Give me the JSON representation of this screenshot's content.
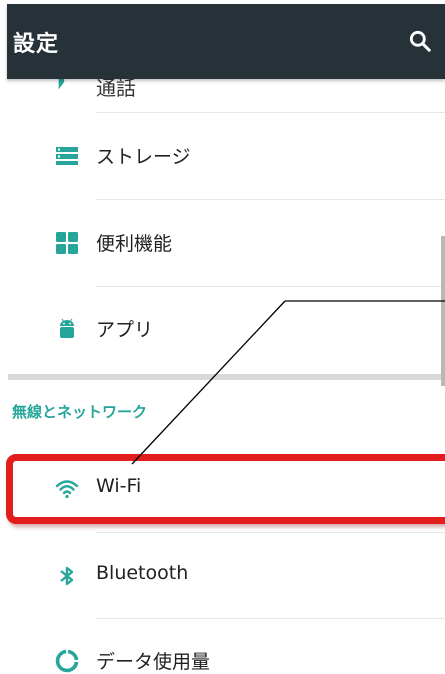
{
  "appbar": {
    "title": "設定",
    "search_icon": "search-icon"
  },
  "partial_item": {
    "label": "通話",
    "icon": "phone-icon"
  },
  "items": [
    {
      "label": "ストレージ",
      "icon": "storage-icon"
    },
    {
      "label": "便利機能",
      "icon": "apps-grid-icon"
    },
    {
      "label": "アプリ",
      "icon": "android-icon"
    }
  ],
  "section_wireless": {
    "title": "無線とネットワーク"
  },
  "wireless_items": [
    {
      "label": "Wi-Fi",
      "icon": "wifi-icon"
    },
    {
      "label": "Bluetooth",
      "icon": "bluetooth-icon"
    },
    {
      "label": "データ使用量",
      "icon": "data-usage-icon"
    }
  ],
  "colors": {
    "appbar": "#263238",
    "accent": "#26a69a",
    "highlight": "#e21d1d"
  }
}
